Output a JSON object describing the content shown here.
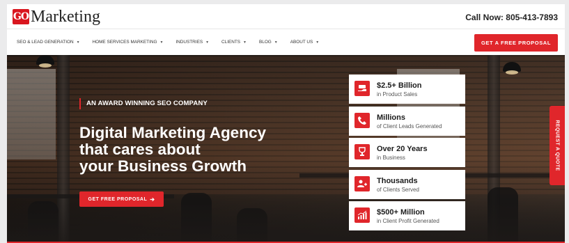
{
  "brand": {
    "logo_badge": "GO",
    "logo_text": "Marketing",
    "accent_color": "#e0262b"
  },
  "header": {
    "call_label": "Call Now:",
    "phone": "805-413-7893",
    "proposal_button": "GET A FREE PROPOSAL"
  },
  "nav": {
    "items": [
      {
        "label": "SEO & LEAD GENERATION",
        "icon": "chevron-down-icon"
      },
      {
        "label": "HOME SERVICES MARKETING",
        "icon": "chevron-down-icon"
      },
      {
        "label": "INDUSTRIES",
        "icon": "chevron-down-icon"
      },
      {
        "label": "CLIENTS",
        "icon": "chevron-down-icon"
      },
      {
        "label": "BLOG",
        "icon": "chevron-down-icon"
      },
      {
        "label": "ABOUT US",
        "icon": "chevron-down-icon"
      }
    ]
  },
  "hero": {
    "tagline": "AN AWARD WINNING SEO COMPANY",
    "headline_line1": "Digital Marketing Agency",
    "headline_line2": "that cares about",
    "headline_line3": "your Business Growth",
    "cta_label": "GET FREE PROPOSAL",
    "cta_icon": "arrow-right-icon"
  },
  "stats": [
    {
      "title": "$2.5+ Billion",
      "subtitle": "in Product Sales",
      "icon": "sales-hand-icon"
    },
    {
      "title": "Millions",
      "subtitle": "of Client Leads Generated",
      "icon": "phone-icon"
    },
    {
      "title": "Over 20 Years",
      "subtitle": "in Business",
      "icon": "trophy-icon"
    },
    {
      "title": "Thousands",
      "subtitle": "of Clients Served",
      "icon": "add-user-icon"
    },
    {
      "title": "$500+ Million",
      "subtitle": "in Client Profit Generated",
      "icon": "growth-chart-icon"
    }
  ],
  "side_tab": {
    "label": "REQUEST A QUOTE"
  }
}
